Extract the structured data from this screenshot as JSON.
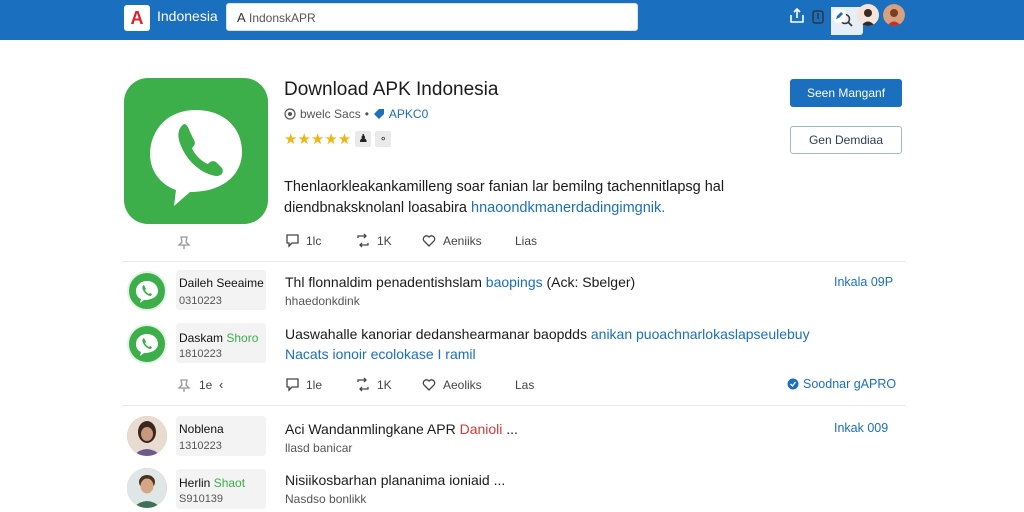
{
  "header": {
    "brand": "Indonesia",
    "search_prefix": "A",
    "search_value": "IndonskAPR"
  },
  "app": {
    "title": "Download APK Indonesia",
    "developer": "bwelc Sacs",
    "tag": "APKC0",
    "rating_stars": "★★★★★",
    "rating_value": 5,
    "primary_button": "Seen Manganf",
    "secondary_button": "Gen Demdiaa",
    "description_plain": "Thenlaorkleakankamilleng soar fanian lar bemilng tachennitlapsg hal diendbnaksknolanl loasabira ",
    "description_link": "hnaoondkmanerdadingimgnik.",
    "stats": {
      "comments": "1lc",
      "reposts": "1K",
      "likes": "Aeniiks",
      "more": "Lias"
    }
  },
  "comments": [
    {
      "name": "Daileh",
      "name_extra": "Seeaime",
      "date": "0310223",
      "text_plain": "Thl flonnaldim penadentishslam ",
      "text_highlight": "baopings",
      "text_after": " (Ack: Sbelger)",
      "sub": "hhaedonkdink",
      "right": "Inkala 09P"
    },
    {
      "name": "Daskam",
      "name_extra": "Shoro",
      "date": "1810223",
      "text_plain": "Uaswahalle kanoriar dedanshearmanar baopdds ",
      "text_highlight": "anikan puoachnarlokaslapseulebuy",
      "text_line2": "Nacats ionoir ecolokase I ramil"
    },
    {
      "name": "Noblena",
      "name_extra": "",
      "date": "1310223",
      "text_plain": "Aci Wandanmlingkane APR ",
      "text_highlight": "Danioli",
      "text_after": "  ...",
      "sub": "llasd banicar",
      "right": "Inkak 009"
    },
    {
      "name": "Herlin",
      "name_extra": "Shaot",
      "date": "S910139",
      "text_plain": "Nisiikosbarhan plananima ioniaid",
      "text_after": "  ...",
      "sub": "Nasdso bonlikk"
    }
  ],
  "thread_actions": {
    "pins": "1e",
    "comments": "1le",
    "reposts": "1K",
    "likes": "Aeoliks",
    "more": "Las",
    "verified": "Soodnar gAPRO"
  },
  "colors": {
    "accent": "#1a6fbf",
    "brand_green": "#3cae4a",
    "star": "#f2b516"
  }
}
